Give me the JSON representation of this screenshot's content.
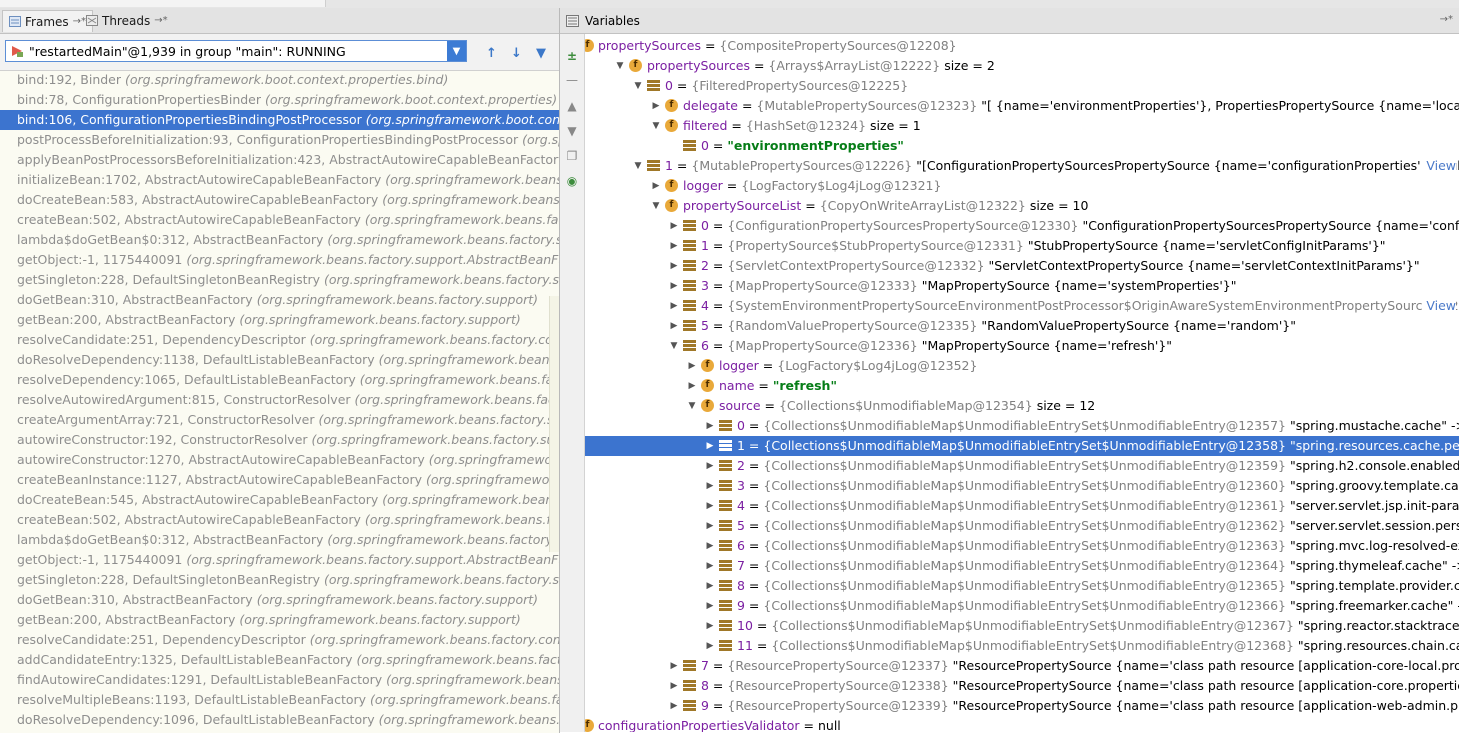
{
  "left": {
    "tabs": [
      {
        "label": "Frames",
        "pin": "→*"
      },
      {
        "label": "Threads",
        "pin": "→*"
      }
    ],
    "thread": "\"restartedMain\"@1,939 in group \"main\": RUNNING",
    "nav": {
      "up": "↑",
      "down": "↓",
      "filter": "▼"
    },
    "frames": [
      {
        "m": "bind:192, Binder",
        "p": "(org.springframework.boot.context.properties.bind)"
      },
      {
        "m": "bind:78, ConfigurationPropertiesBinder",
        "p": "(org.springframework.boot.context.properties)"
      },
      {
        "m": "bind:106, ConfigurationPropertiesBindingPostProcessor",
        "p": "(org.springframework.boot.context.p"
      },
      {
        "m": "postProcessBeforeInitialization:93, ConfigurationPropertiesBindingPostProcessor",
        "p": "(org.spring"
      },
      {
        "m": "applyBeanPostProcessorsBeforeInitialization:423, AbstractAutowireCapableBeanFactory",
        "p": "(or"
      },
      {
        "m": "initializeBean:1702, AbstractAutowireCapableBeanFactory",
        "p": "(org.springframework.beans.factory"
      },
      {
        "m": "doCreateBean:583, AbstractAutowireCapableBeanFactory",
        "p": "(org.springframework.beans.factor"
      },
      {
        "m": "createBean:502, AbstractAutowireCapableBeanFactory",
        "p": "(org.springframework.beans.factory.su"
      },
      {
        "m": "lambda$doGetBean$0:312, AbstractBeanFactory",
        "p": "(org.springframework.beans.factory.support)"
      },
      {
        "m": "getObject:-1, 1175440091",
        "p": "(org.springframework.beans.factory.support.AbstractBeanFactory$$l"
      },
      {
        "m": "getSingleton:228, DefaultSingletonBeanRegistry",
        "p": "(org.springframework.beans.factory.support)"
      },
      {
        "m": "doGetBean:310, AbstractBeanFactory",
        "p": "(org.springframework.beans.factory.support)"
      },
      {
        "m": "getBean:200, AbstractBeanFactory",
        "p": "(org.springframework.beans.factory.support)"
      },
      {
        "m": "resolveCandidate:251, DependencyDescriptor",
        "p": "(org.springframework.beans.factory.config)"
      },
      {
        "m": "doResolveDependency:1138, DefaultListableBeanFactory",
        "p": "(org.springframework.beans.factory"
      },
      {
        "m": "resolveDependency:1065, DefaultListableBeanFactory",
        "p": "(org.springframework.beans.factory.sup"
      },
      {
        "m": "resolveAutowiredArgument:815, ConstructorResolver",
        "p": "(org.springframework.beans.factory.sup"
      },
      {
        "m": "createArgumentArray:721, ConstructorResolver",
        "p": "(org.springframework.beans.factory.support)"
      },
      {
        "m": "autowireConstructor:192, ConstructorResolver",
        "p": "(org.springframework.beans.factory.support)"
      },
      {
        "m": "autowireConstructor:1270, AbstractAutowireCapableBeanFactory",
        "p": "(org.springframework.bea"
      },
      {
        "m": "createBeanInstance:1127, AbstractAutowireCapableBeanFactory",
        "p": "(org.springframework.bean"
      },
      {
        "m": "doCreateBean:545, AbstractAutowireCapableBeanFactory",
        "p": "(org.springframework.beans.factor"
      },
      {
        "m": "createBean:502, AbstractAutowireCapableBeanFactory",
        "p": "(org.springframework.beans.factory.su"
      },
      {
        "m": "lambda$doGetBean$0:312, AbstractBeanFactory",
        "p": "(org.springframework.beans.factory.support)"
      },
      {
        "m": "getObject:-1, 1175440091",
        "p": "(org.springframework.beans.factory.support.AbstractBeanFactory$$l"
      },
      {
        "m": "getSingleton:228, DefaultSingletonBeanRegistry",
        "p": "(org.springframework.beans.factory.support)"
      },
      {
        "m": "doGetBean:310, AbstractBeanFactory",
        "p": "(org.springframework.beans.factory.support)"
      },
      {
        "m": "getBean:200, AbstractBeanFactory",
        "p": "(org.springframework.beans.factory.support)"
      },
      {
        "m": "resolveCandidate:251, DependencyDescriptor",
        "p": "(org.springframework.beans.factory.config)"
      },
      {
        "m": "addCandidateEntry:1325, DefaultListableBeanFactory",
        "p": "(org.springframework.beans.factory.sup"
      },
      {
        "m": "findAutowireCandidates:1291, DefaultListableBeanFactory",
        "p": "(org.springframework.beans.facto"
      },
      {
        "m": "resolveMultipleBeans:1193, DefaultListableBeanFactory",
        "p": "(org.springframework.beans.factory.s"
      },
      {
        "m": "doResolveDependency:1096, DefaultListableBeanFactory",
        "p": "(org.springframework.beans.factory"
      }
    ]
  },
  "right": {
    "title": "Variables",
    "pin": "→*",
    "view_link": "View",
    "rows": [
      {
        "d": 0,
        "tw": "",
        "ic": "f",
        "name": "propertySources",
        "ref": "{CompositePropertySources@12208}",
        "extra": ""
      },
      {
        "d": 1,
        "tw": "▼",
        "ic": "f",
        "name": "propertySources",
        "ref": "{Arrays$ArrayList@12222}",
        "extra": " size = 2"
      },
      {
        "d": 2,
        "tw": "▼",
        "ic": "l",
        "name": "0",
        "ref": "{FilteredPropertySources@12225}",
        "extra": ""
      },
      {
        "d": 3,
        "tw": "▶",
        "ic": "f",
        "name": "delegate",
        "ref": "{MutablePropertySources@12323}",
        "extra": " \"[ {name='environmentProperties'}, PropertiesPropertySource {name='localProperties'}]\""
      },
      {
        "d": 3,
        "tw": "▼",
        "ic": "f",
        "name": "filtered",
        "ref": "{HashSet@12324}",
        "extra": " size = 1"
      },
      {
        "d": 4,
        "tw": "",
        "ic": "l",
        "name": "0",
        "ref": "",
        "str": "\"environmentProperties\"",
        "extra": ""
      },
      {
        "d": 2,
        "tw": "▼",
        "ic": "l",
        "name": "1",
        "ref": "{MutablePropertySources@12226}",
        "extra": " \"[ConfigurationPropertySourcesPropertySource {name='configurationProperties'}, StubProper",
        "ell": "…",
        "view": true
      },
      {
        "d": 3,
        "tw": "▶",
        "ic": "f",
        "name": "logger",
        "ref": "{LogFactory$Log4jLog@12321}",
        "extra": ""
      },
      {
        "d": 3,
        "tw": "▼",
        "ic": "f",
        "name": "propertySourceList",
        "ref": "{CopyOnWriteArrayList@12322}",
        "extra": " size = 10"
      },
      {
        "d": 4,
        "tw": "▶",
        "ic": "l",
        "name": "0",
        "ref": "{ConfigurationPropertySourcesPropertySource@12330}",
        "extra": " \"ConfigurationPropertySourcesPropertySource {name='configurationPrope"
      },
      {
        "d": 4,
        "tw": "▶",
        "ic": "l",
        "name": "1",
        "ref": "{PropertySource$StubPropertySource@12331}",
        "extra": " \"StubPropertySource {name='servletConfigInitParams'}\""
      },
      {
        "d": 4,
        "tw": "▶",
        "ic": "l",
        "name": "2",
        "ref": "{ServletContextPropertySource@12332}",
        "extra": " \"ServletContextPropertySource {name='servletContextInitParams'}\""
      },
      {
        "d": 4,
        "tw": "▶",
        "ic": "l",
        "name": "3",
        "ref": "{MapPropertySource@12333}",
        "extra": " \"MapPropertySource {name='systemProperties'}\""
      },
      {
        "d": 4,
        "tw": "▶",
        "ic": "l",
        "name": "4",
        "ref": "{SystemEnvironmentPropertySourceEnvironmentPostProcessor$OriginAwareSystemEnvironmentPropertySource@12334}",
        "extra": " \"",
        "ell": "…",
        "view": true
      },
      {
        "d": 4,
        "tw": "▶",
        "ic": "l",
        "name": "5",
        "ref": "{RandomValuePropertySource@12335}",
        "extra": " \"RandomValuePropertySource {name='random'}\""
      },
      {
        "d": 4,
        "tw": "▼",
        "ic": "l",
        "name": "6",
        "ref": "{MapPropertySource@12336}",
        "extra": " \"MapPropertySource {name='refresh'}\""
      },
      {
        "d": 5,
        "tw": "▶",
        "ic": "f",
        "name": "logger",
        "ref": "{LogFactory$Log4jLog@12352}",
        "extra": ""
      },
      {
        "d": 5,
        "tw": "▶",
        "ic": "f",
        "name": "name",
        "ref": "",
        "str": "\"refresh\"",
        "extra": ""
      },
      {
        "d": 5,
        "tw": "▼",
        "ic": "f",
        "name": "source",
        "ref": "{Collections$UnmodifiableMap@12354}",
        "extra": " size = 12"
      },
      {
        "d": 6,
        "tw": "▶",
        "ic": "l",
        "name": "0",
        "ref": "{Collections$UnmodifiableMap$UnmodifiableEntrySet$UnmodifiableEntry@12357}",
        "extra": " \"spring.mustache.cache\" -> \"false\""
      },
      {
        "d": 6,
        "tw": "▶",
        "ic": "l",
        "name": "1",
        "ref": "{Collections$UnmodifiableMap$UnmodifiableEntrySet$UnmodifiableEntry@12358}",
        "extra": " \"spring.resources.cache.period\" -> \"0\"",
        "sel": true
      },
      {
        "d": 6,
        "tw": "▶",
        "ic": "l",
        "name": "2",
        "ref": "{Collections$UnmodifiableMap$UnmodifiableEntrySet$UnmodifiableEntry@12359}",
        "extra": " \"spring.h2.console.enabled\" -> \"true\""
      },
      {
        "d": 6,
        "tw": "▶",
        "ic": "l",
        "name": "3",
        "ref": "{Collections$UnmodifiableMap$UnmodifiableEntrySet$UnmodifiableEntry@12360}",
        "extra": " \"spring.groovy.template.cache\" -> \"false\""
      },
      {
        "d": 6,
        "tw": "▶",
        "ic": "l",
        "name": "4",
        "ref": "{Collections$UnmodifiableMap$UnmodifiableEntrySet$UnmodifiableEntry@12361}",
        "extra": " \"server.servlet.jsp.init-parameters.develo"
      },
      {
        "d": 6,
        "tw": "▶",
        "ic": "l",
        "name": "5",
        "ref": "{Collections$UnmodifiableMap$UnmodifiableEntrySet$UnmodifiableEntry@12362}",
        "extra": " \"server.servlet.session.persistent\" -> \"true"
      },
      {
        "d": 6,
        "tw": "▶",
        "ic": "l",
        "name": "6",
        "ref": "{Collections$UnmodifiableMap$UnmodifiableEntrySet$UnmodifiableEntry@12363}",
        "extra": " \"spring.mvc.log-resolved-exception\" -> \"t"
      },
      {
        "d": 6,
        "tw": "▶",
        "ic": "l",
        "name": "7",
        "ref": "{Collections$UnmodifiableMap$UnmodifiableEntrySet$UnmodifiableEntry@12364}",
        "extra": " \"spring.thymeleaf.cache\" -> \"false\""
      },
      {
        "d": 6,
        "tw": "▶",
        "ic": "l",
        "name": "8",
        "ref": "{Collections$UnmodifiableMap$UnmodifiableEntrySet$UnmodifiableEntry@12365}",
        "extra": " \"spring.template.provider.cache\" -> \"false"
      },
      {
        "d": 6,
        "tw": "▶",
        "ic": "l",
        "name": "9",
        "ref": "{Collections$UnmodifiableMap$UnmodifiableEntrySet$UnmodifiableEntry@12366}",
        "extra": " \"spring.freemarker.cache\" -> \"false\""
      },
      {
        "d": 6,
        "tw": "▶",
        "ic": "l",
        "name": "10",
        "ref": "{Collections$UnmodifiableMap$UnmodifiableEntrySet$UnmodifiableEntry@12367}",
        "extra": " \"spring.reactor.stacktrace-mode.enabled"
      },
      {
        "d": 6,
        "tw": "▶",
        "ic": "l",
        "name": "11",
        "ref": "{Collections$UnmodifiableMap$UnmodifiableEntrySet$UnmodifiableEntry@12368}",
        "extra": " \"spring.resources.chain.cache\" -> \"false\""
      },
      {
        "d": 4,
        "tw": "▶",
        "ic": "l",
        "name": "7",
        "ref": "{ResourcePropertySource@12337}",
        "extra": " \"ResourcePropertySource {name='class path resource [application-core-local.properties]'}\""
      },
      {
        "d": 4,
        "tw": "▶",
        "ic": "l",
        "name": "8",
        "ref": "{ResourcePropertySource@12338}",
        "extra": " \"ResourcePropertySource {name='class path resource [application-core.properties]'}\""
      },
      {
        "d": 4,
        "tw": "▶",
        "ic": "l",
        "name": "9",
        "ref": "{ResourcePropertySource@12339}",
        "extra": " \"ResourcePropertySource {name='class path resource [application-web-admin.properties]'}\""
      },
      {
        "d": 0,
        "tw": "",
        "ic": "f",
        "name": "configurationPropertiesValidator",
        "ref": "",
        "extra": " = null"
      }
    ]
  },
  "colors": {
    "selection": "#3c74cf",
    "name": "#7b1fa2",
    "string": "#067d17",
    "ref": "#808080"
  }
}
